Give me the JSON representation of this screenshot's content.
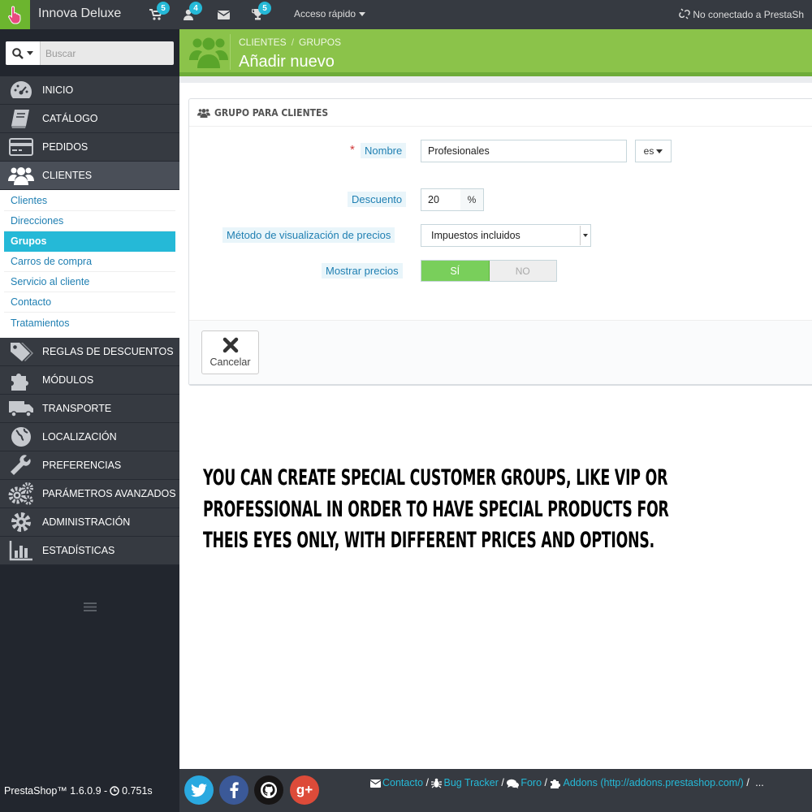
{
  "topbar": {
    "shop_name": "Innova Deluxe",
    "orders_badge": "5",
    "customers_badge": "4",
    "trophy_badge": "5",
    "quick_access": "Acceso rápido",
    "connection_status": "No conectado a PrestaSh"
  },
  "sidebar": {
    "search_button_icon": "search-icon",
    "search_placeholder": "Buscar",
    "menu_top": [
      {
        "label": "INICIO",
        "icon": "dashboard-icon"
      },
      {
        "label": "CATÁLOGO",
        "icon": "book-icon"
      },
      {
        "label": "PEDIDOS",
        "icon": "credit-card-icon"
      },
      {
        "label": "CLIENTES",
        "icon": "users-icon"
      }
    ],
    "submenu": [
      {
        "label": "Clientes"
      },
      {
        "label": "Direcciones"
      },
      {
        "label": "Grupos"
      },
      {
        "label": "Carros de compra"
      },
      {
        "label": "Servicio al cliente"
      },
      {
        "label": "Contacto"
      },
      {
        "label": "Tratamientos"
      }
    ],
    "menu_bottom": [
      {
        "label": "REGLAS DE DESCUENTOS",
        "icon": "tag-icon"
      },
      {
        "label": "MÓDULOS",
        "icon": "puzzle-icon"
      },
      {
        "label": "TRANSPORTE",
        "icon": "truck-icon"
      },
      {
        "label": "LOCALIZACIÓN",
        "icon": "globe-icon"
      },
      {
        "label": "PREFERENCIAS",
        "icon": "wrench-icon"
      },
      {
        "label": "PARÁMETROS AVANZADOS",
        "icon": "cogs-icon"
      },
      {
        "label": "ADMINISTRACIÓN",
        "icon": "cog-icon"
      },
      {
        "label": "ESTADÍSTICAS",
        "icon": "bar-chart-icon"
      }
    ]
  },
  "header": {
    "breadcrumb": [
      "CLIENTES",
      "GRUPOS"
    ],
    "breadcrumb_separator": "/",
    "title": "Añadir nuevo"
  },
  "panel": {
    "title": "GRUPO PARA CLIENTES",
    "required_mark": "*",
    "name_label": "Nombre",
    "name_value": "Profesionales",
    "language": "es",
    "discount_label": "Descuento",
    "discount_value": "20",
    "discount_unit": "%",
    "price_display_label": "Método de visualización de precios",
    "price_display_value": "Impuestos incluidos",
    "show_prices_label": "Mostrar precios",
    "show_prices_yes": "SÍ",
    "show_prices_no": "NO",
    "cancel_label": "Cancelar"
  },
  "promo": {
    "line1": "YOU CAN CREATE SPECIAL CUSTOMER GROUPS, LIKE VIP OR",
    "line2": "PROFESSIONAL IN ORDER TO HAVE SPECIAL PRODUCTS FOR",
    "line3": "THEIS EYES ONLY, WITH DIFFERENT PRICES AND OPTIONS."
  },
  "footer": {
    "version": "PrestaShop™ 1.6.0.9 - ",
    "load_time": "0.751s",
    "links": [
      {
        "label": "Contacto",
        "icon": "envelope-icon"
      },
      {
        "label": "Bug Tracker",
        "icon": "bug-icon"
      },
      {
        "label": "Foro",
        "icon": "comments-icon"
      },
      {
        "label": "Addons (http://addons.prestashop.com/)",
        "icon": "puzzle-icon"
      }
    ],
    "link_separator": "/",
    "ellipsis": "...",
    "social": [
      {
        "name": "twitter",
        "color": "#2aa9e0"
      },
      {
        "name": "facebook",
        "color": "#3b5998"
      },
      {
        "name": "github",
        "color": "#171515"
      },
      {
        "name": "google-plus",
        "color": "#dd4b39"
      }
    ]
  },
  "colors": {
    "accent_green": "#8bc34a",
    "active_blue": "#25b9d7",
    "sidebar_dark": "#363a41"
  }
}
